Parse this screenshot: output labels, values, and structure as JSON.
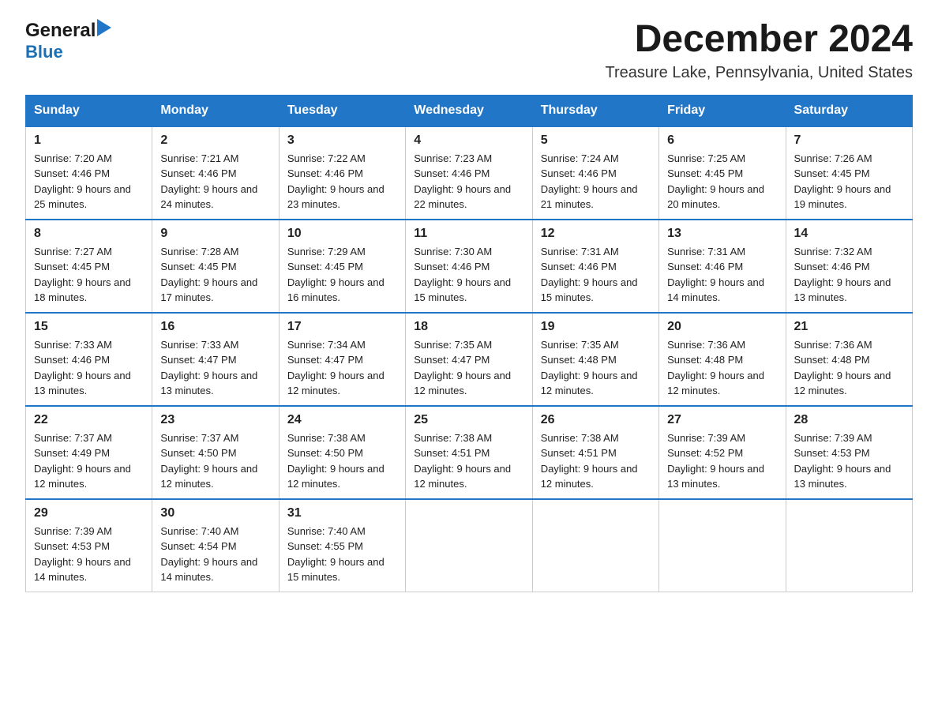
{
  "logo": {
    "line1": "General",
    "arrow": "▶",
    "line2": "Blue"
  },
  "title": "December 2024",
  "location": "Treasure Lake, Pennsylvania, United States",
  "weekdays": [
    "Sunday",
    "Monday",
    "Tuesday",
    "Wednesday",
    "Thursday",
    "Friday",
    "Saturday"
  ],
  "weeks": [
    [
      {
        "day": 1,
        "sunrise": "7:20 AM",
        "sunset": "4:46 PM",
        "daylight": "9 hours and 25 minutes."
      },
      {
        "day": 2,
        "sunrise": "7:21 AM",
        "sunset": "4:46 PM",
        "daylight": "9 hours and 24 minutes."
      },
      {
        "day": 3,
        "sunrise": "7:22 AM",
        "sunset": "4:46 PM",
        "daylight": "9 hours and 23 minutes."
      },
      {
        "day": 4,
        "sunrise": "7:23 AM",
        "sunset": "4:46 PM",
        "daylight": "9 hours and 22 minutes."
      },
      {
        "day": 5,
        "sunrise": "7:24 AM",
        "sunset": "4:46 PM",
        "daylight": "9 hours and 21 minutes."
      },
      {
        "day": 6,
        "sunrise": "7:25 AM",
        "sunset": "4:45 PM",
        "daylight": "9 hours and 20 minutes."
      },
      {
        "day": 7,
        "sunrise": "7:26 AM",
        "sunset": "4:45 PM",
        "daylight": "9 hours and 19 minutes."
      }
    ],
    [
      {
        "day": 8,
        "sunrise": "7:27 AM",
        "sunset": "4:45 PM",
        "daylight": "9 hours and 18 minutes."
      },
      {
        "day": 9,
        "sunrise": "7:28 AM",
        "sunset": "4:45 PM",
        "daylight": "9 hours and 17 minutes."
      },
      {
        "day": 10,
        "sunrise": "7:29 AM",
        "sunset": "4:45 PM",
        "daylight": "9 hours and 16 minutes."
      },
      {
        "day": 11,
        "sunrise": "7:30 AM",
        "sunset": "4:46 PM",
        "daylight": "9 hours and 15 minutes."
      },
      {
        "day": 12,
        "sunrise": "7:31 AM",
        "sunset": "4:46 PM",
        "daylight": "9 hours and 15 minutes."
      },
      {
        "day": 13,
        "sunrise": "7:31 AM",
        "sunset": "4:46 PM",
        "daylight": "9 hours and 14 minutes."
      },
      {
        "day": 14,
        "sunrise": "7:32 AM",
        "sunset": "4:46 PM",
        "daylight": "9 hours and 13 minutes."
      }
    ],
    [
      {
        "day": 15,
        "sunrise": "7:33 AM",
        "sunset": "4:46 PM",
        "daylight": "9 hours and 13 minutes."
      },
      {
        "day": 16,
        "sunrise": "7:33 AM",
        "sunset": "4:47 PM",
        "daylight": "9 hours and 13 minutes."
      },
      {
        "day": 17,
        "sunrise": "7:34 AM",
        "sunset": "4:47 PM",
        "daylight": "9 hours and 12 minutes."
      },
      {
        "day": 18,
        "sunrise": "7:35 AM",
        "sunset": "4:47 PM",
        "daylight": "9 hours and 12 minutes."
      },
      {
        "day": 19,
        "sunrise": "7:35 AM",
        "sunset": "4:48 PM",
        "daylight": "9 hours and 12 minutes."
      },
      {
        "day": 20,
        "sunrise": "7:36 AM",
        "sunset": "4:48 PM",
        "daylight": "9 hours and 12 minutes."
      },
      {
        "day": 21,
        "sunrise": "7:36 AM",
        "sunset": "4:48 PM",
        "daylight": "9 hours and 12 minutes."
      }
    ],
    [
      {
        "day": 22,
        "sunrise": "7:37 AM",
        "sunset": "4:49 PM",
        "daylight": "9 hours and 12 minutes."
      },
      {
        "day": 23,
        "sunrise": "7:37 AM",
        "sunset": "4:50 PM",
        "daylight": "9 hours and 12 minutes."
      },
      {
        "day": 24,
        "sunrise": "7:38 AM",
        "sunset": "4:50 PM",
        "daylight": "9 hours and 12 minutes."
      },
      {
        "day": 25,
        "sunrise": "7:38 AM",
        "sunset": "4:51 PM",
        "daylight": "9 hours and 12 minutes."
      },
      {
        "day": 26,
        "sunrise": "7:38 AM",
        "sunset": "4:51 PM",
        "daylight": "9 hours and 12 minutes."
      },
      {
        "day": 27,
        "sunrise": "7:39 AM",
        "sunset": "4:52 PM",
        "daylight": "9 hours and 13 minutes."
      },
      {
        "day": 28,
        "sunrise": "7:39 AM",
        "sunset": "4:53 PM",
        "daylight": "9 hours and 13 minutes."
      }
    ],
    [
      {
        "day": 29,
        "sunrise": "7:39 AM",
        "sunset": "4:53 PM",
        "daylight": "9 hours and 14 minutes."
      },
      {
        "day": 30,
        "sunrise": "7:40 AM",
        "sunset": "4:54 PM",
        "daylight": "9 hours and 14 minutes."
      },
      {
        "day": 31,
        "sunrise": "7:40 AM",
        "sunset": "4:55 PM",
        "daylight": "9 hours and 15 minutes."
      },
      null,
      null,
      null,
      null
    ]
  ]
}
